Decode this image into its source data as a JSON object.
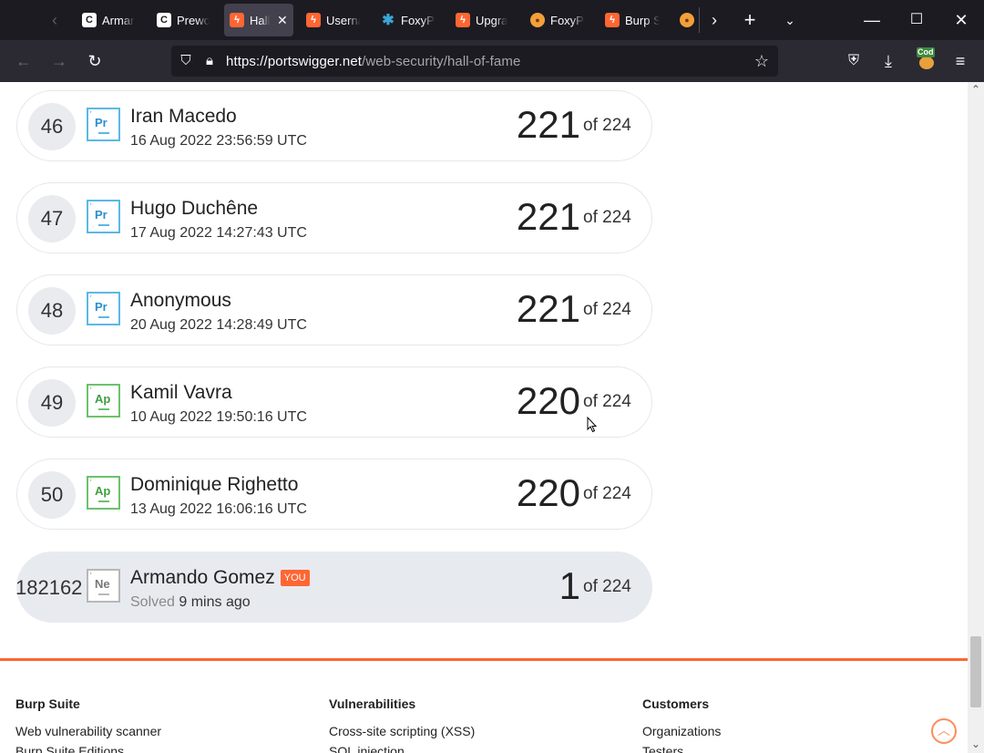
{
  "browser": {
    "tabs": [
      {
        "label": "Arman",
        "favicon": "c-icon",
        "active": false
      },
      {
        "label": "Prewo",
        "favicon": "c-icon",
        "active": false
      },
      {
        "label": "Hall",
        "favicon": "portswigger-icon",
        "active": true
      },
      {
        "label": "Userna",
        "favicon": "portswigger-icon",
        "active": false
      },
      {
        "label": "FoxyPr",
        "favicon": "foxyproxy-icon",
        "active": false
      },
      {
        "label": "Upgra",
        "favicon": "portswigger-icon",
        "active": false
      },
      {
        "label": "FoxyPr",
        "favicon": "foxy-orange-icon",
        "active": false
      },
      {
        "label": "Burp S",
        "favicon": "portswigger-icon",
        "active": false
      }
    ],
    "url_host": "https://portswigger.net",
    "url_path": "/web-security/hall-of-fame",
    "ext_label": "Cod"
  },
  "leaderboard": {
    "total_label": "of 224",
    "rows": [
      {
        "rank": "46",
        "badge": "Pr",
        "name": "Iran Macedo",
        "date": "16 Aug 2022 23:56:59 UTC",
        "score": "221"
      },
      {
        "rank": "47",
        "badge": "Pr",
        "name": "Hugo Duchêne",
        "date": "17 Aug 2022 14:27:43 UTC",
        "score": "221"
      },
      {
        "rank": "48",
        "badge": "Pr",
        "name": "Anonymous",
        "date": "20 Aug 2022 14:28:49 UTC",
        "score": "221"
      },
      {
        "rank": "49",
        "badge": "Ap",
        "name": "Kamil Vavra",
        "date": "10 Aug 2022 19:50:16 UTC",
        "score": "220"
      },
      {
        "rank": "50",
        "badge": "Ap",
        "name": "Dominique Righetto",
        "date": "13 Aug 2022 16:06:16 UTC",
        "score": "220"
      }
    ],
    "you_row": {
      "rank": "182162",
      "badge": "Ne",
      "name": "Armando Gomez",
      "you_tag": "YOU",
      "solved_label": "Solved",
      "solved_time": "9 mins ago",
      "score": "1"
    }
  },
  "footer": {
    "col1": {
      "title": "Burp Suite",
      "links": [
        "Web vulnerability scanner",
        "Burp Suite Editions"
      ]
    },
    "col2": {
      "title": "Vulnerabilities",
      "links": [
        "Cross-site scripting (XSS)",
        "SQL injection"
      ]
    },
    "col3": {
      "title": "Customers",
      "links": [
        "Organizations",
        "Testers"
      ]
    }
  },
  "colors": {
    "accent": "#ff6633",
    "practitioner": "#5bb8e6",
    "apprentice": "#6cc26c",
    "newcomer": "#b8b8b8"
  }
}
